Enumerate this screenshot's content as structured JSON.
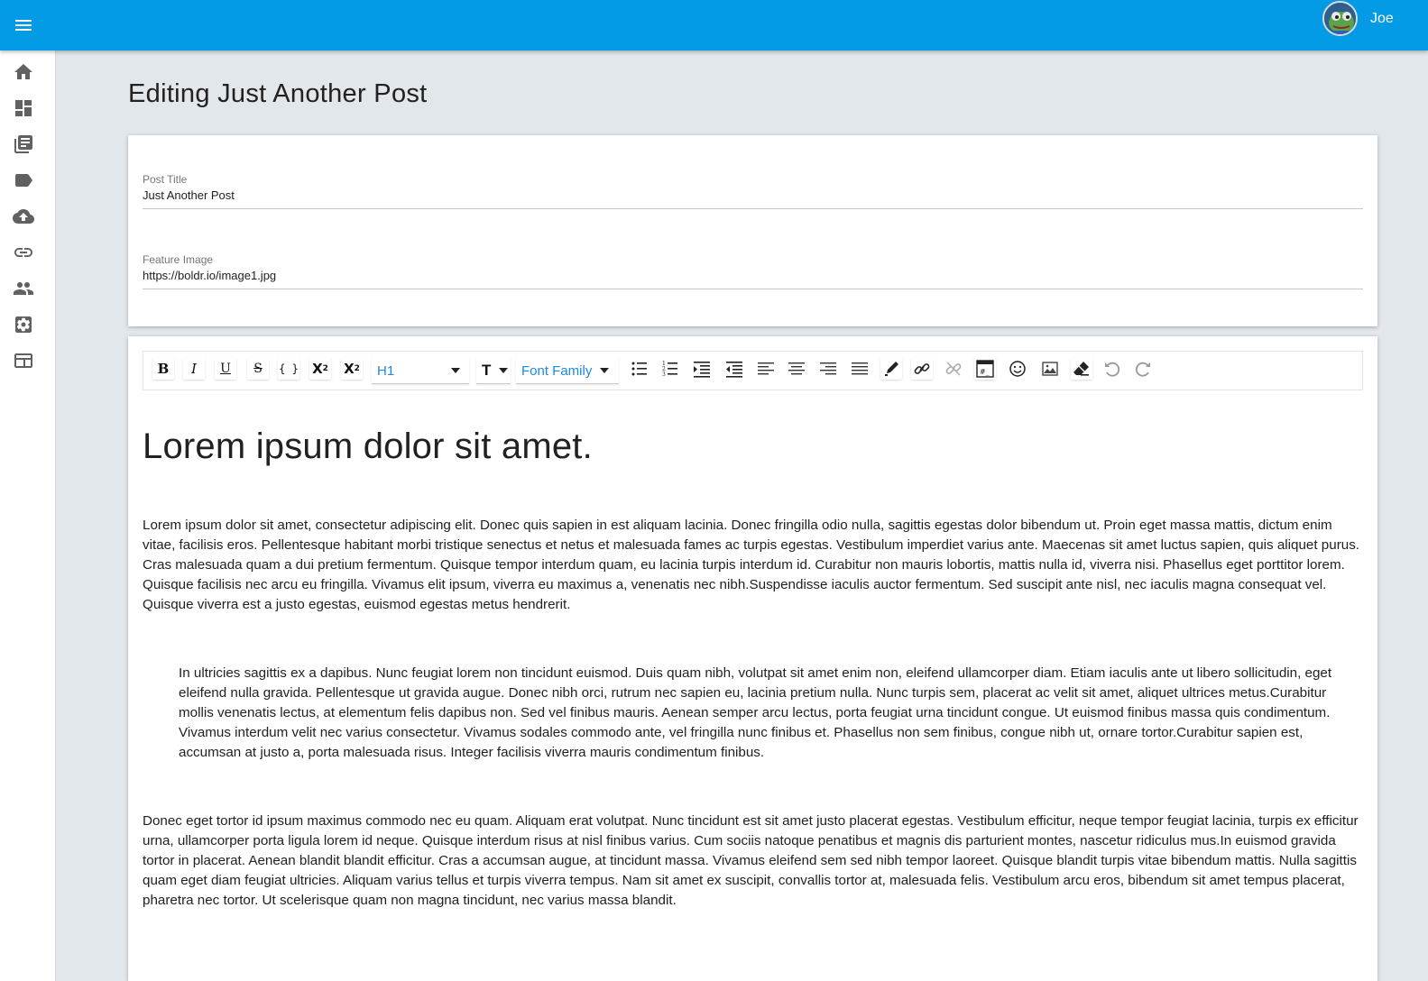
{
  "header": {
    "user_name": "Joe",
    "menu_icon": "hamburger-menu-icon",
    "avatar_icon": "user-avatar"
  },
  "sidebar": {
    "items": [
      {
        "icon": "home-icon"
      },
      {
        "icon": "dashboard-icon"
      },
      {
        "icon": "posts-icon"
      },
      {
        "icon": "tag-icon"
      },
      {
        "icon": "cloud-upload-icon"
      },
      {
        "icon": "link-icon"
      },
      {
        "icon": "people-icon"
      },
      {
        "icon": "settings-icon"
      },
      {
        "icon": "template-icon"
      }
    ]
  },
  "page": {
    "title": "Editing Just Another Post"
  },
  "form": {
    "post_title_label": "Post Title",
    "post_title_value": "Just Another Post",
    "feature_image_label": "Feature Image",
    "feature_image_value": "https://boldr.io/image1.jpg"
  },
  "toolbar": {
    "bold": "B",
    "italic": "I",
    "underline": "U",
    "strikethrough": "S",
    "code": "{ }",
    "superscript_base": "X",
    "superscript_exp": "2",
    "subscript_base": "X",
    "subscript_exp": "2",
    "block_type_value": "H1",
    "font_size_glyph": "T",
    "font_family_value": "Font Family",
    "accent_color": "#1e88e5"
  },
  "editor": {
    "heading": "Lorem ipsum dolor sit amet.",
    "paragraph_1": "Lorem ipsum dolor sit amet, consectetur adipiscing elit. Donec quis sapien in est aliquam lacinia. Donec fringilla odio nulla, sagittis egestas dolor bibendum ut. Proin eget massa mattis, dictum enim vitae, facilisis eros. Pellentesque habitant morbi tristique senectus et netus et malesuada fames ac turpis egestas. Vestibulum imperdiet varius ante. Maecenas sit amet luctus sapien, quis aliquet purus. Cras malesuada quam a dui pretium fermentum. Quisque tempor interdum quam, eu lacinia turpis interdum id. Curabitur non mauris lobortis, mattis nulla id, viverra nisi. Phasellus eget porttitor lorem. Quisque facilisis nec arcu eu fringilla. Vivamus elit ipsum, viverra eu maximus a, venenatis nec nibh.Suspendisse iaculis auctor fermentum. Sed suscipit ante nisl, nec iaculis magna consequat vel. Quisque viverra est a justo egestas, euismod egestas metus hendrerit.",
    "paragraph_2": " In ultricies sagittis ex a dapibus. Nunc feugiat lorem non tincidunt euismod. Duis quam nibh, volutpat sit amet enim non, eleifend ullamcorper diam. Etiam iaculis ante ut libero sollicitudin, eget eleifend nulla gravida. Pellentesque ut gravida augue. Donec nibh orci, rutrum nec sapien eu, lacinia pretium nulla. Nunc turpis sem, placerat ac velit sit amet, aliquet ultrices metus.Curabitur mollis venenatis lectus, at elementum felis dapibus non. Sed vel finibus mauris. Aenean semper arcu lectus, porta feugiat urna tincidunt congue. Ut euismod finibus massa quis condimentum. Vivamus interdum velit nec varius consectetur. Vivamus sodales commodo ante, vel fringilla nunc finibus et. Phasellus non sem finibus, congue nibh ut, ornare tortor.Curabitur sapien est, accumsan at justo a, porta malesuada risus. Integer facilisis viverra mauris condimentum finibus.",
    "paragraph_3": " Donec eget tortor id ipsum maximus commodo nec eu quam. Aliquam erat volutpat. Nunc tincidunt est sit amet justo placerat egestas. Vestibulum efficitur, neque tempor feugiat lacinia, turpis ex efficitur urna, ullamcorper porta ligula lorem id neque. Quisque interdum risus at nisl finibus varius. Cum sociis natoque penatibus et magnis dis parturient montes, nascetur ridiculus mus.In euismod gravida tortor in placerat. Aenean blandit blandit efficitur. Cras a accumsan augue, at tincidunt massa. Vivamus eleifend sem sed nibh tempor laoreet. Quisque blandit turpis vitae bibendum mattis. Nulla sagittis quam eget diam feugiat ultricies. Aliquam varius tellus et turpis viverra tempus. Nam sit amet ex suscipit, convallis tortor at, malesuada felis. Vestibulum arcu eros, bibendum sit amet tempus placerat, pharetra nec tortor. Ut scelerisque quam non magna tincidunt, nec varius massa blandit."
  },
  "colors": {
    "app_bar": "#039be5",
    "background": "#e2e7ec",
    "icon_gray": "#616161"
  }
}
